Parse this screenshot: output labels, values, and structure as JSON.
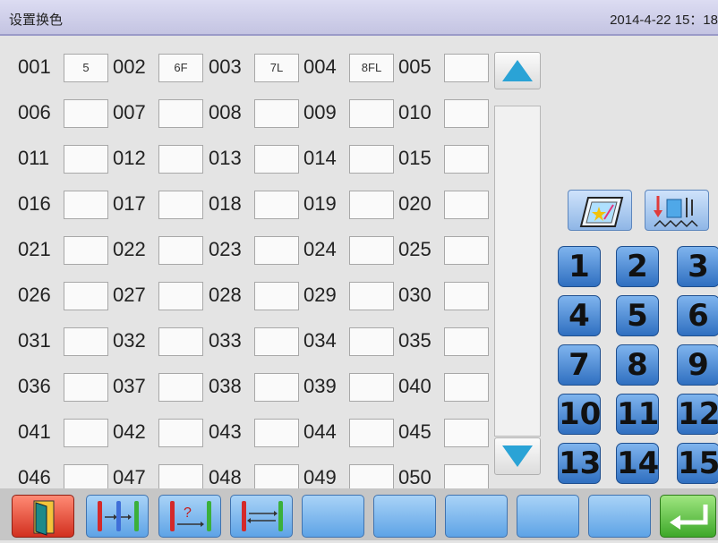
{
  "window": {
    "title": "设置换色",
    "datetime": "2014-4-22 15：18"
  },
  "slots": [
    {
      "num": "001",
      "value": "5"
    },
    {
      "num": "002",
      "value": "6F"
    },
    {
      "num": "003",
      "value": "7L"
    },
    {
      "num": "004",
      "value": "8FL"
    },
    {
      "num": "005",
      "value": ""
    },
    {
      "num": "006",
      "value": ""
    },
    {
      "num": "007",
      "value": ""
    },
    {
      "num": "008",
      "value": ""
    },
    {
      "num": "009",
      "value": ""
    },
    {
      "num": "010",
      "value": ""
    },
    {
      "num": "011",
      "value": ""
    },
    {
      "num": "012",
      "value": ""
    },
    {
      "num": "013",
      "value": ""
    },
    {
      "num": "014",
      "value": ""
    },
    {
      "num": "015",
      "value": ""
    },
    {
      "num": "016",
      "value": ""
    },
    {
      "num": "017",
      "value": ""
    },
    {
      "num": "018",
      "value": ""
    },
    {
      "num": "019",
      "value": ""
    },
    {
      "num": "020",
      "value": ""
    },
    {
      "num": "021",
      "value": ""
    },
    {
      "num": "022",
      "value": ""
    },
    {
      "num": "023",
      "value": ""
    },
    {
      "num": "024",
      "value": ""
    },
    {
      "num": "025",
      "value": ""
    },
    {
      "num": "026",
      "value": ""
    },
    {
      "num": "027",
      "value": ""
    },
    {
      "num": "028",
      "value": ""
    },
    {
      "num": "029",
      "value": ""
    },
    {
      "num": "030",
      "value": ""
    },
    {
      "num": "031",
      "value": ""
    },
    {
      "num": "032",
      "value": ""
    },
    {
      "num": "033",
      "value": ""
    },
    {
      "num": "034",
      "value": ""
    },
    {
      "num": "035",
      "value": ""
    },
    {
      "num": "036",
      "value": ""
    },
    {
      "num": "037",
      "value": ""
    },
    {
      "num": "038",
      "value": ""
    },
    {
      "num": "039",
      "value": ""
    },
    {
      "num": "040",
      "value": ""
    },
    {
      "num": "041",
      "value": ""
    },
    {
      "num": "042",
      "value": ""
    },
    {
      "num": "043",
      "value": ""
    },
    {
      "num": "044",
      "value": ""
    },
    {
      "num": "045",
      "value": ""
    },
    {
      "num": "046",
      "value": ""
    },
    {
      "num": "047",
      "value": ""
    },
    {
      "num": "048",
      "value": ""
    },
    {
      "num": "049",
      "value": ""
    },
    {
      "num": "050",
      "value": ""
    }
  ],
  "keypad": [
    "1",
    "2",
    "3",
    "4",
    "5",
    "6",
    "7",
    "8",
    "9",
    "10",
    "11",
    "12",
    "13",
    "14",
    "15"
  ],
  "side_buttons": [
    {
      "icon": "frame-star-icon"
    },
    {
      "icon": "needle-stitch-icon"
    }
  ],
  "toolbar": [
    {
      "icon": "exit-door-icon"
    },
    {
      "icon": "needle-swap-icon"
    },
    {
      "icon": "needle-query-icon"
    },
    {
      "icon": "needle-exchange-icon"
    },
    {
      "icon": "empty"
    },
    {
      "icon": "empty"
    },
    {
      "icon": "empty"
    },
    {
      "icon": "empty"
    },
    {
      "icon": "empty"
    },
    {
      "icon": "enter-icon"
    }
  ],
  "colors": {
    "accent": "#2aa3d6",
    "keypad": "#3a7fd0",
    "exit": "#e24a3a",
    "enter": "#58c23a"
  }
}
